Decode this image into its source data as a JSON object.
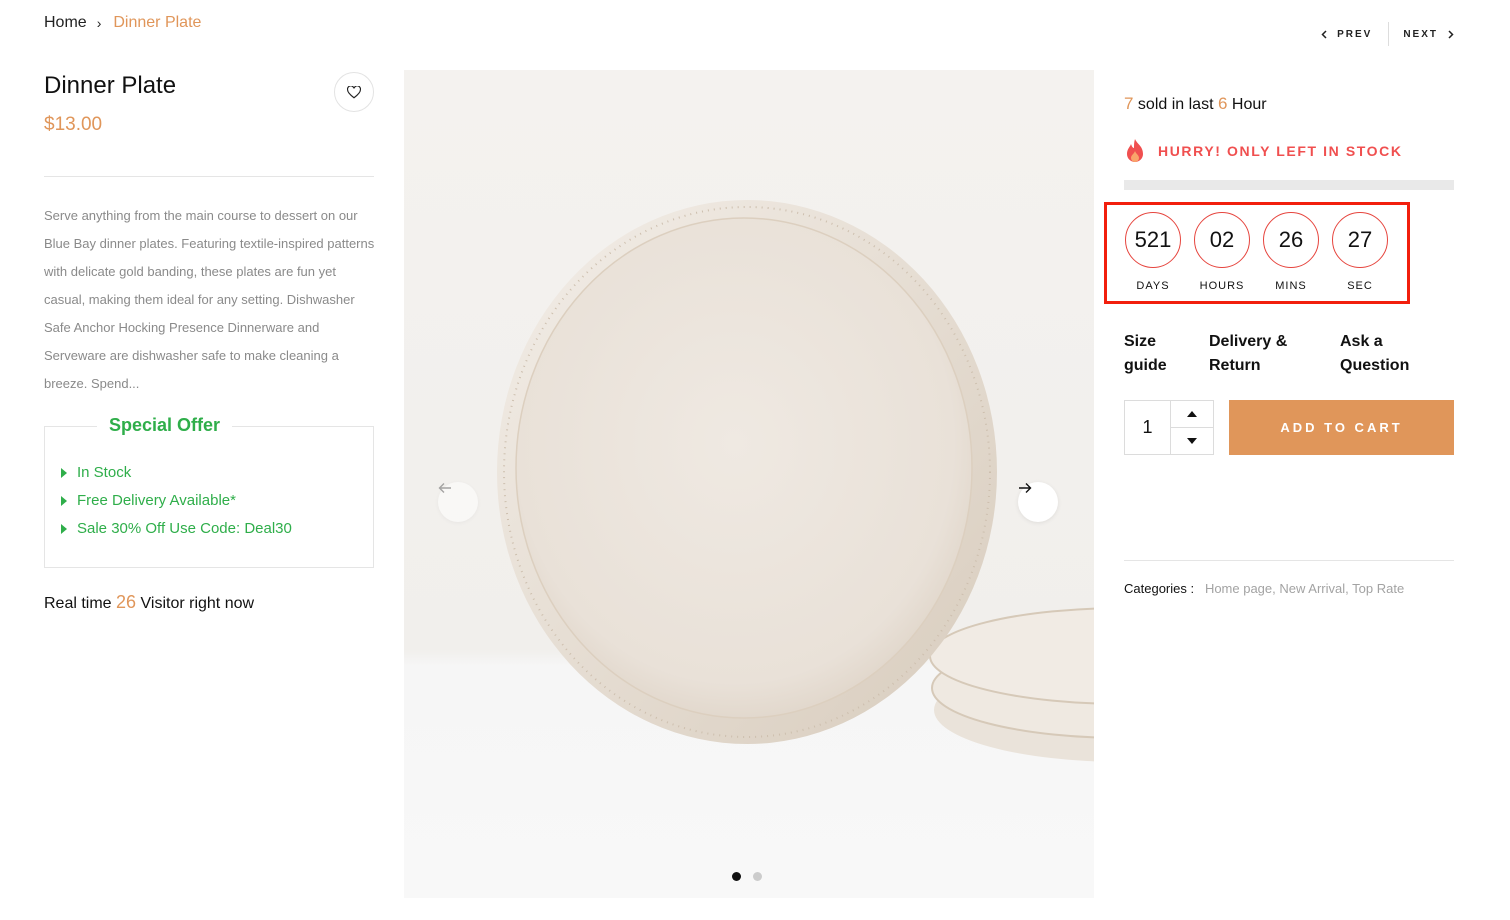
{
  "breadcrumb": {
    "home": "Home",
    "current": "Dinner Plate"
  },
  "nav": {
    "prev": "PREV",
    "next": "NEXT"
  },
  "product": {
    "title": "Dinner Plate",
    "price": "$13.00",
    "description": "Serve anything from the main course to dessert on our Blue Bay dinner plates. Featuring textile-inspired patterns with delicate gold banding, these plates are fun yet casual, making them ideal for any setting. Dishwasher Safe Anchor Hocking Presence Dinnerware and Serveware are dishwasher safe to make cleaning a breeze. Spend..."
  },
  "offer": {
    "title": "Special Offer",
    "items": [
      "In Stock",
      "Free Delivery Available*",
      "Sale 30% Off Use Code: Deal30"
    ]
  },
  "visitors": {
    "prefix": "Real time",
    "count": "26",
    "suffix": "Visitor right now"
  },
  "sales": {
    "count": "7",
    "mid": "sold in last",
    "hours": "6",
    "unit": "Hour"
  },
  "stock": {
    "message": "HURRY! ONLY LEFT IN STOCK",
    "level": 0
  },
  "countdown": [
    {
      "value": "521",
      "label": "DAYS"
    },
    {
      "value": "02",
      "label": "HOURS"
    },
    {
      "value": "26",
      "label": "MINS"
    },
    {
      "value": "27",
      "label": "SEC"
    }
  ],
  "links": {
    "size_guide": [
      "Size",
      "guide"
    ],
    "delivery": [
      "Delivery &",
      "Return"
    ],
    "ask": [
      "Ask a",
      "Question"
    ]
  },
  "cart": {
    "quantity": "1",
    "button": "ADD TO CART"
  },
  "categories": {
    "label": "Categories :",
    "items": [
      "Home page,",
      "New Arrival,",
      "Top Rate"
    ]
  },
  "gallery": {
    "slides": 2,
    "active": 0
  },
  "colors": {
    "accent": "#e0965a",
    "offer": "#2fae4a",
    "alert": "#f04f4f",
    "highlight": "#f21f0d"
  },
  "icons": {
    "wishlist": "heart-icon",
    "fire": "fire-icon",
    "prev": "arrow-left-icon",
    "next": "arrow-right-icon",
    "qty_up": "caret-up-icon",
    "qty_down": "caret-down-icon"
  }
}
